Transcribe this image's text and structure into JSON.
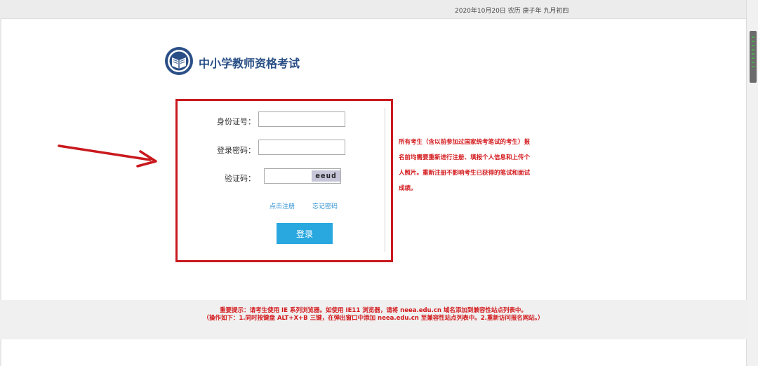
{
  "header": {
    "date_text": "2020年10月20日 农历 庚子年 九月初四"
  },
  "site": {
    "title": "中小学教师资格考试",
    "logo_icon": "emblem-book-icon"
  },
  "login": {
    "id_label": "身份证号：",
    "id_value": "",
    "password_label": "登录密码：",
    "password_value": "",
    "captcha_label": "验证码：",
    "captcha_value": "",
    "captcha_text": "eeud",
    "register_link": "点击注册",
    "forgot_link": "忘记密码",
    "submit_label": "登录"
  },
  "notice": {
    "text": "所有考生（含以前参加过国家统考笔试的考生）报名前均需要重新进行注册、填报个人信息和上传个人照片。重新注册不影响考生已获得的笔试和面试成绩。"
  },
  "footer": {
    "line1": "重要提示：请考生使用 IE 系列浏览器。如使用 IE11 浏览器，请将 neea.edu.cn 域名添加到兼容性站点列表中。",
    "line2": "（操作如下：1.同时按键盘 ALT+X+B 三键，在弹出窗口中添加 neea.edu.cn 至兼容性站点列表中。2.重新访问报名网站。）"
  },
  "colors": {
    "highlight_red": "#c9191e",
    "title_blue": "#2a4f86",
    "button_blue": "#29a8e0",
    "link_blue": "#2b8fd1"
  }
}
